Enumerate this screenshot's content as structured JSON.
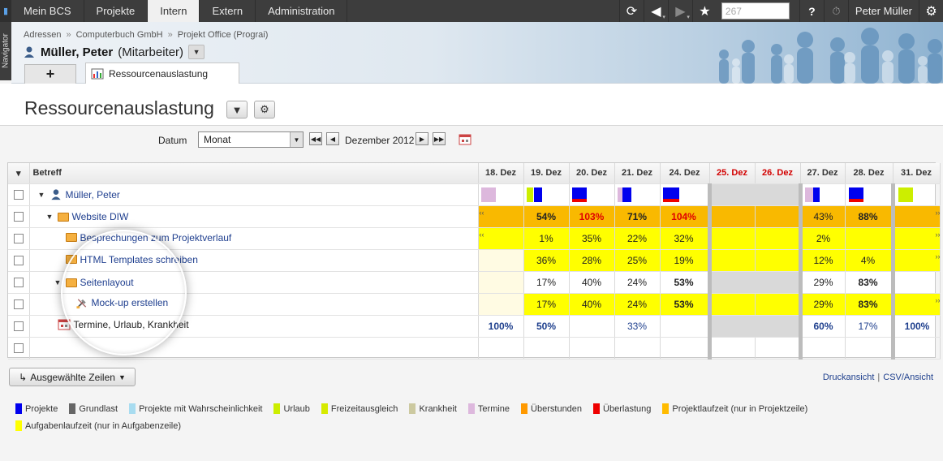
{
  "topnav": {
    "tabs": [
      {
        "label": "Mein BCS",
        "active": false
      },
      {
        "label": "Projekte",
        "active": false
      },
      {
        "label": "Intern",
        "active": true
      },
      {
        "label": "Extern",
        "active": false
      },
      {
        "label": "Administration",
        "active": false
      }
    ],
    "search_value": "267",
    "help_label": "?",
    "user_name": "Peter Müller",
    "icons": [
      "refresh-icon",
      "back-icon",
      "forward-icon",
      "star-icon",
      "timer-icon",
      "gear-icon"
    ]
  },
  "navigator_label": "Navigator",
  "breadcrumb": [
    "Adressen",
    "Computerbuch GmbH",
    "Projekt Office (Prograi)"
  ],
  "person": {
    "name": "Müller, Peter",
    "role": "(Mitarbeiter)"
  },
  "tabs": {
    "add_label": "+",
    "doc_label": "Ressourcenauslastung"
  },
  "page_title": "Ressourcenauslastung",
  "filter": {
    "label": "Datum",
    "selected": "Monat",
    "period": "Dezember 2012"
  },
  "grid": {
    "name_header": "Betreff",
    "columns": [
      {
        "label": "18. Dez",
        "weekend": false
      },
      {
        "label": "19. Dez",
        "weekend": false
      },
      {
        "label": "20. Dez",
        "weekend": false
      },
      {
        "label": "21. Dez",
        "weekend": false
      },
      {
        "label": "24. Dez",
        "weekend": false
      },
      {
        "label": "25. Dez",
        "weekend": true
      },
      {
        "label": "26. Dez",
        "weekend": true
      },
      {
        "label": "27. Dez",
        "weekend": false
      },
      {
        "label": "28. Dez",
        "weekend": false
      },
      {
        "label": "31. Dez",
        "weekend": false
      }
    ],
    "rows": [
      {
        "name": "Müller, Peter",
        "type": "person",
        "indent": 0,
        "cells": [
          "",
          "",
          "",
          "",
          "",
          "",
          "",
          "",
          "",
          ""
        ]
      },
      {
        "name": "Website DIW",
        "type": "project",
        "indent": 1,
        "cells": [
          "",
          "54%",
          "103%",
          "71%",
          "104%",
          "",
          "",
          "43%",
          "88%",
          ""
        ]
      },
      {
        "name": "Besprechungen zum Projektverlauf",
        "type": "folder",
        "indent": 2,
        "cells": [
          "",
          "1%",
          "35%",
          "22%",
          "32%",
          "",
          "",
          "2%",
          "",
          ""
        ]
      },
      {
        "name": "HTML Templates schreiben",
        "type": "folder",
        "indent": 2,
        "cells": [
          "",
          "36%",
          "28%",
          "25%",
          "19%",
          "",
          "",
          "12%",
          "4%",
          ""
        ]
      },
      {
        "name": "Seitenlayout",
        "type": "folder",
        "indent": 2,
        "cells": [
          "",
          "17%",
          "40%",
          "24%",
          "53%",
          "",
          "",
          "29%",
          "83%",
          ""
        ]
      },
      {
        "name": "Mock-up erstellen",
        "type": "task",
        "indent": 3,
        "cells": [
          "",
          "17%",
          "40%",
          "24%",
          "53%",
          "",
          "",
          "29%",
          "83%",
          ""
        ]
      },
      {
        "name": "Termine, Urlaub, Krankheit",
        "type": "calendar",
        "indent": 1,
        "cells": [
          "100%",
          "50%",
          "",
          "33%",
          "",
          "",
          "",
          "60%",
          "17%",
          "100%"
        ]
      }
    ]
  },
  "bottom": {
    "selected_rows_label": "Ausgewählte Zeilen",
    "print_label": "Druckansicht",
    "csv_label": "CSV/Ansicht"
  },
  "legend": [
    {
      "label": "Projekte",
      "color": "#0000ee"
    },
    {
      "label": "Grundlast",
      "color": "#666666"
    },
    {
      "label": "Projekte mit Wahrscheinlichkeit",
      "color": "#a8dcf0"
    },
    {
      "label": "Urlaub",
      "color": "#ccee00"
    },
    {
      "label": "Freizeitausgleich",
      "color": "#d6ea00"
    },
    {
      "label": "Krankheit",
      "color": "#ccc9a0"
    },
    {
      "label": "Termine",
      "color": "#ddb8dd"
    },
    {
      "label": "Überstunden",
      "color": "#ff9900"
    },
    {
      "label": "Überlastung",
      "color": "#ee0000"
    },
    {
      "label": "Projektlaufzeit (nur in Projektzeile)",
      "color": "#ffbb00"
    },
    {
      "label": "Aufgabenlaufzeit (nur in Aufgabenzeile)",
      "color": "#ffff00"
    }
  ]
}
